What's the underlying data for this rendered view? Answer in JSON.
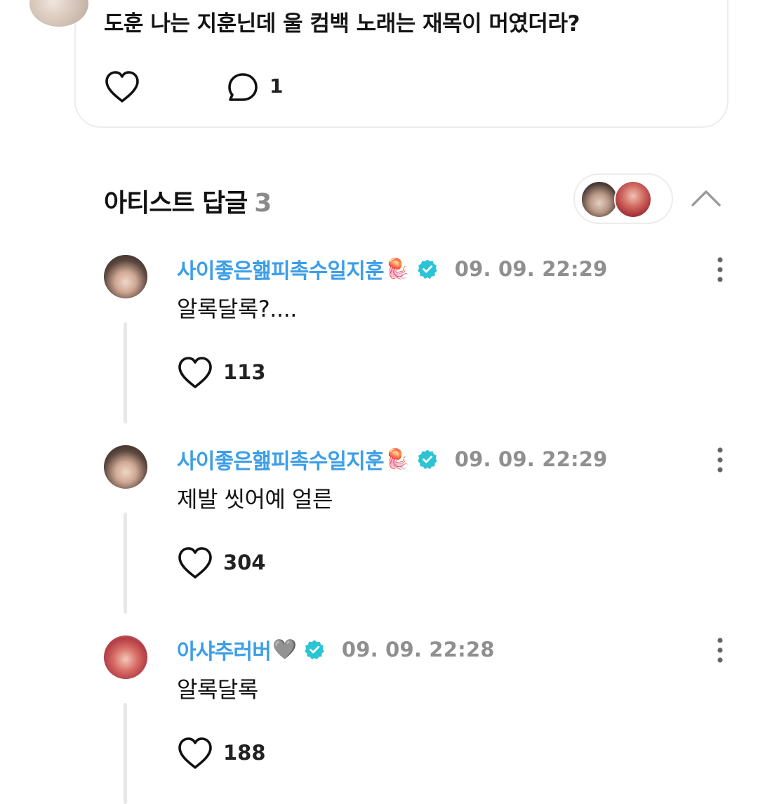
{
  "post": {
    "text": "도훈 나는 지훈닌데 울 컴백 노래는 재목이 머였더라?",
    "comment_count": "1"
  },
  "section": {
    "title": "아티스트 답글",
    "count": "3"
  },
  "replies": [
    {
      "author": "사이좋은햂피촉수일지훈",
      "author_emoji": "🪼",
      "timestamp": "09. 09. 22:29",
      "text": "알록달록?....",
      "likes": "113"
    },
    {
      "author": "사이좋은햂피촉수일지훈",
      "author_emoji": "🪼",
      "timestamp": "09. 09. 22:29",
      "text": "제발 씻어예 얼른",
      "likes": "304"
    },
    {
      "author": "아샤추러버",
      "author_emoji": "🩶",
      "timestamp": "09. 09. 22:28",
      "text": "알록달록",
      "likes": "188"
    }
  ],
  "colors": {
    "author_name": "#3c9ee8",
    "verified_badge": "#2bc4d6",
    "timestamp": "#8f8f8f",
    "count_gray": "#8a8a8a"
  },
  "icons": {
    "like": "heart-outline-icon",
    "comment": "speech-bubble-icon",
    "collapse": "chevron-up-icon",
    "more": "more-vertical-icon",
    "verified": "verified-badge-icon"
  }
}
